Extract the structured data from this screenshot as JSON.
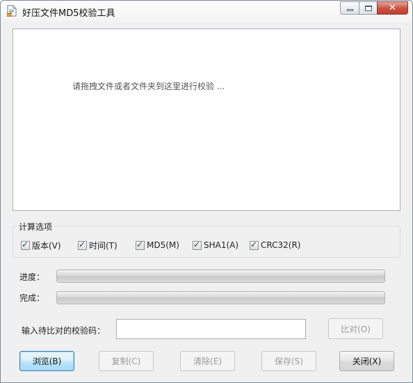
{
  "window": {
    "title": "好压文件MD5校验工具"
  },
  "drop_area": {
    "hint": "请拖拽文件或者文件夹到这里进行校验 ..."
  },
  "options": {
    "legend": "计算选项",
    "items": [
      {
        "label": "版本(V)",
        "checked": true
      },
      {
        "label": "时间(T)",
        "checked": true
      },
      {
        "label": "MD5(M)",
        "checked": true
      },
      {
        "label": "SHA1(A)",
        "checked": true
      },
      {
        "label": "CRC32(R)",
        "checked": true
      }
    ]
  },
  "progress": {
    "progress_label": "进度：",
    "progress_value": 0,
    "complete_label": "完成：",
    "complete_value": 0
  },
  "compare": {
    "label": "输入待比对的校验码：",
    "input_value": "",
    "button": "比对(O)"
  },
  "buttons": {
    "browse": "浏览(B)",
    "copy": "复制(C)",
    "clear": "清除(E)",
    "save": "保存(S)",
    "close": "关闭(X)"
  },
  "icons": {
    "app": "document-icon",
    "minimize": "minimize-icon",
    "maximize": "maximize-icon",
    "close": "close-icon"
  },
  "colors": {
    "window_bg": "#f0f0f0",
    "close_button": "#c7443a",
    "default_button": "#bee6fd"
  }
}
